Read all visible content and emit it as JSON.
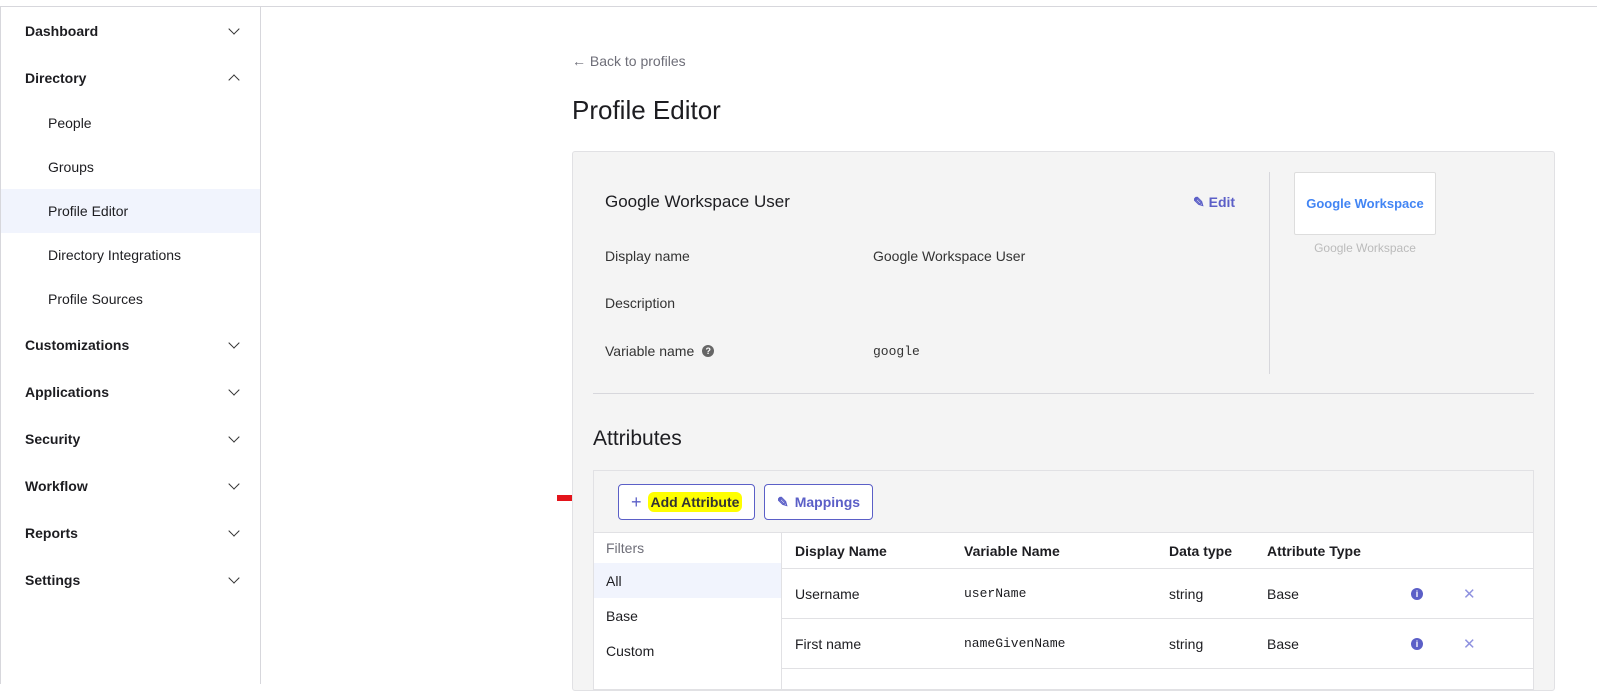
{
  "sidebar": {
    "items": [
      {
        "label": "Dashboard",
        "expanded": false
      },
      {
        "label": "Directory",
        "expanded": true,
        "children": [
          "People",
          "Groups",
          "Profile Editor",
          "Directory Integrations",
          "Profile Sources"
        ],
        "active_child": "Profile Editor"
      },
      {
        "label": "Customizations"
      },
      {
        "label": "Applications"
      },
      {
        "label": "Security"
      },
      {
        "label": "Workflow"
      },
      {
        "label": "Reports"
      },
      {
        "label": "Settings"
      }
    ]
  },
  "main": {
    "back_link": "← Back to profiles",
    "title": "Profile Editor",
    "profile": {
      "name": "Google Workspace User",
      "edit_label": "Edit",
      "fields": [
        {
          "label": "Display name",
          "value": "Google Workspace User"
        },
        {
          "label": "Description",
          "value": ""
        },
        {
          "label": "Variable name",
          "value": "google"
        }
      ],
      "logo_text": "Google Workspace",
      "logo_caption": "Google Workspace"
    },
    "attributes": {
      "heading": "Attributes",
      "add_button": "Add Attribute",
      "mappings_button": "Mappings",
      "filters_label": "Filters",
      "filters": [
        "All",
        "Base",
        "Custom"
      ],
      "active_filter": "All",
      "columns": [
        "Display Name",
        "Variable Name",
        "Data type",
        "Attribute Type"
      ],
      "rows": [
        {
          "display": "Username",
          "variable": "userName",
          "type": "string",
          "attr_type": "Base"
        },
        {
          "display": "First name",
          "variable": "nameGivenName",
          "type": "string",
          "attr_type": "Base"
        }
      ]
    }
  },
  "colors": {
    "accent": "#5b5fc7",
    "highlight": "#ffff00",
    "arrow": "#e3141b"
  }
}
